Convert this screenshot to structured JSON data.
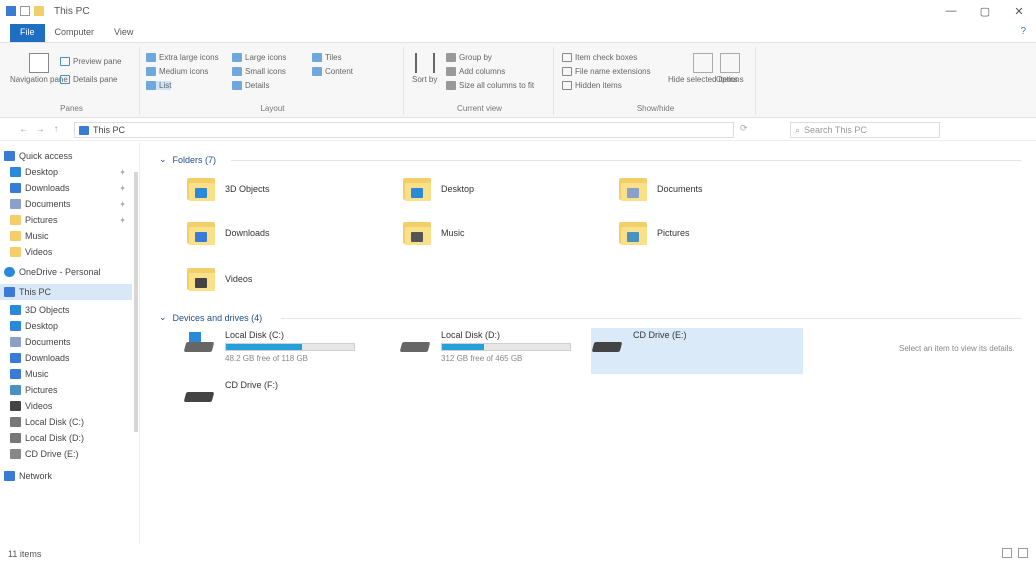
{
  "window": {
    "title": "This PC",
    "minimize": "—",
    "maximize": "▢",
    "close": "✕"
  },
  "tabs": [
    {
      "label": "File"
    },
    {
      "label": "Computer"
    },
    {
      "label": "View"
    }
  ],
  "help_icon": "?",
  "ribbon": {
    "groups": {
      "panes": {
        "label": "Panes",
        "navigation_pane": "Navigation pane",
        "preview_pane": "Preview pane",
        "details_pane": "Details pane"
      },
      "layout": {
        "label": "Layout",
        "items": [
          "Extra large icons",
          "Large icons",
          "Medium icons",
          "Small icons",
          "List",
          "Details",
          "Tiles",
          "Content"
        ]
      },
      "current_view": {
        "label": "Current view",
        "group_by": "Group by",
        "add_columns": "Add columns",
        "size_all_columns": "Size all columns to fit",
        "sort_by": "Sort by"
      },
      "show_hide": {
        "label": "Show/hide",
        "item_check_boxes": "Item check boxes",
        "file_name_extensions": "File name extensions",
        "hidden_items": "Hidden items",
        "hide_selected": "Hide selected items",
        "options": "Options"
      }
    }
  },
  "address": {
    "back": "←",
    "forward": "→",
    "up": "↑",
    "path": "This PC",
    "refresh": "⟳",
    "search_placeholder": "Search This PC"
  },
  "sidebar": {
    "items": [
      {
        "label": "Quick access",
        "pinned": false
      },
      {
        "label": "Desktop",
        "pinned": true
      },
      {
        "label": "Downloads",
        "pinned": true
      },
      {
        "label": "Documents",
        "pinned": true
      },
      {
        "label": "Pictures",
        "pinned": true
      },
      {
        "label": "Music",
        "pinned": false
      },
      {
        "label": "Videos",
        "pinned": false
      },
      {
        "label": "OneDrive - Personal",
        "pinned": false
      },
      {
        "label": "This PC",
        "pinned": false
      },
      {
        "label": "3D Objects",
        "pinned": false
      },
      {
        "label": "Desktop",
        "pinned": false
      },
      {
        "label": "Documents",
        "pinned": false
      },
      {
        "label": "Downloads",
        "pinned": false
      },
      {
        "label": "Music",
        "pinned": false
      },
      {
        "label": "Pictures",
        "pinned": false
      },
      {
        "label": "Videos",
        "pinned": false
      },
      {
        "label": "Local Disk (C:)",
        "pinned": false
      },
      {
        "label": "Local Disk (D:)",
        "pinned": false
      },
      {
        "label": "CD Drive (E:)",
        "pinned": false
      },
      {
        "label": "Network",
        "pinned": false
      }
    ]
  },
  "content": {
    "folders_header": "Folders (7)",
    "drives_header": "Devices and drives (4)",
    "folders": [
      {
        "name": "3D Objects",
        "badge_color": "#2a8ad8"
      },
      {
        "name": "Desktop",
        "badge_color": "#2a8ad8"
      },
      {
        "name": "Documents",
        "badge_color": "#8aa0c8"
      },
      {
        "name": "Downloads",
        "badge_color": "#3a7bd5"
      },
      {
        "name": "Music",
        "badge_color": "#555555"
      },
      {
        "name": "Pictures",
        "badge_color": "#4a90c0"
      },
      {
        "name": "Videos",
        "badge_color": "#444444"
      }
    ],
    "drives": [
      {
        "name": "Local Disk (C:)",
        "free": "48.2 GB free of 118 GB",
        "used_fraction": 0.59
      },
      {
        "name": "Local Disk (D:)",
        "free": "312 GB free of 465 GB",
        "used_fraction": 0.33
      },
      {
        "name": "CD Drive (E:)",
        "free": "",
        "used_fraction": 0
      },
      {
        "name": "CD Drive (F:)",
        "free": "",
        "used_fraction": 0
      }
    ],
    "details_hint": "Select an item to view its details."
  },
  "status": {
    "items": "11 items"
  },
  "colors": {
    "accent": "#1e6fc2",
    "selection": "#d9e8f6",
    "folder": "#f3cf6a",
    "drive_bar": "#26a0da"
  }
}
